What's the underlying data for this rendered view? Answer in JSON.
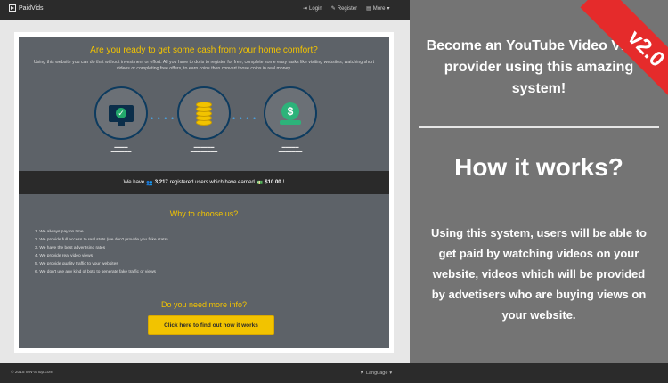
{
  "navbar": {
    "brand": "PaidVids",
    "links": [
      {
        "icon": "login-icon",
        "label": "Login"
      },
      {
        "icon": "register-icon",
        "label": "Register"
      },
      {
        "icon": "more-icon",
        "label": "More"
      }
    ]
  },
  "hero": {
    "title": "Are you ready to get some cash from your home comfort?",
    "text": "Using this website you can do that without investment or effort. All you have to do is to register for free, complete some easy tasks like visiting websites, watching short videos or completing free offers, to earn coins then convert those coins in real money."
  },
  "stats": {
    "text_before": "We have",
    "users": "3,217",
    "text_middle": "registered users which have earned",
    "amount": "$10.00",
    "text_after": "!"
  },
  "why": {
    "title": "Why to choose us?",
    "items": [
      "1. We always pay on time",
      "2. We provide full access to real stats (we don't provide you fake stats)",
      "3. We have the best advertising rates",
      "4. We provide real video views",
      "5. We provide quality traffic to your websites",
      "6. We don't use any kind of bots to generate fake traffic or views"
    ]
  },
  "more_info": {
    "title": "Do you need more info?",
    "button": "Click here to find out how it works"
  },
  "footer": {
    "copyright": "© 2015 MN-Shop.com",
    "language": "Language"
  },
  "promo": {
    "headline": "Become an YouTube Video Views provider using this amazing system!",
    "how": "How it works?",
    "body": "Using this system, users will be able to get paid by watching videos on your website, videos which will be provided by advetisers who are buying views on your website.",
    "ribbon": "v2.0"
  },
  "colors": {
    "accent": "#f2c300",
    "navbar": "#2b2b2b",
    "ribbon": "#e52b2b"
  }
}
